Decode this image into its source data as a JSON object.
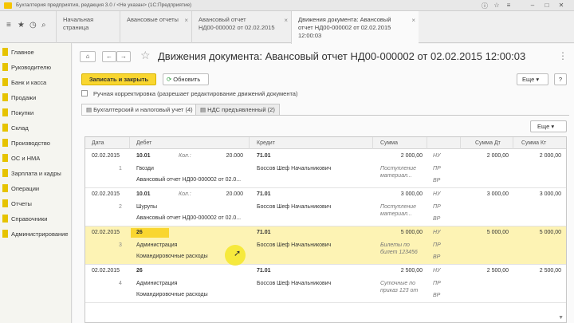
{
  "window": {
    "title": "Бухгалтерия предприятия, редакция 3.0 / <Не указан> (1С:Предприятие)"
  },
  "tabs": [
    {
      "label": "Начальная страница",
      "sub": ""
    },
    {
      "label": "Авансовые отчеты",
      "sub": ""
    },
    {
      "label": "Авансовый отчет",
      "sub": "НД00-000002 от 02.02.2015"
    },
    {
      "label": "Движения документа: Авансовый",
      "sub": "отчет НД00-000002 от 02.02.2015 12:00:03"
    }
  ],
  "sidebar": {
    "items": [
      {
        "label": "Главное"
      },
      {
        "label": "Руководителю"
      },
      {
        "label": "Банк и касса"
      },
      {
        "label": "Продажи"
      },
      {
        "label": "Покупки"
      },
      {
        "label": "Склад"
      },
      {
        "label": "Производство"
      },
      {
        "label": "ОС и НМА"
      },
      {
        "label": "Зарплата и кадры"
      },
      {
        "label": "Операции"
      },
      {
        "label": "Отчеты"
      },
      {
        "label": "Справочники"
      },
      {
        "label": "Администрирование"
      }
    ]
  },
  "main": {
    "title": "Движения документа: Авансовый отчет НД00-000002 от 02.02.2015 12:00:03",
    "more_label": "Еще",
    "save_close_label": "Записать и закрыть",
    "refresh_label": "Обновить",
    "manual_label": "Ручная корректировка (разрешает редактирование движений документа)",
    "inner_tabs": [
      {
        "label": "Бухгалтерский и налоговый учет (4)"
      },
      {
        "label": "НДС предъявленный (2)"
      }
    ],
    "table_more_label": "Еще"
  },
  "table": {
    "headers": {
      "date": "Дата",
      "debit": "Дебет",
      "credit": "Кредит",
      "amount": "Сумма",
      "amount_dt": "Сумма Дт",
      "amount_kt": "Сумма Кт"
    },
    "rows": [
      {
        "date": "02.02.2015",
        "num": "1",
        "debit_acc": "10.01",
        "qty_label": "Кол.:",
        "qty": "20.000",
        "debit_sub1": "Гвозди",
        "debit_sub2": "Авансовый отчет НД00-000002 от 02.0...",
        "credit_acc": "71.01",
        "credit_sub1": "Боссов Шеф Начальникович",
        "amount": "2 000,00",
        "content1": "Поступление",
        "content2": "материал...",
        "nu": "НУ",
        "pr": "ПР",
        "vr": "ВР",
        "amount_dt": "2 000,00",
        "amount_kt": "2 000,00"
      },
      {
        "date": "02.02.2015",
        "num": "2",
        "debit_acc": "10.01",
        "qty_label": "Кол.:",
        "qty": "20.000",
        "debit_sub1": "Шурупы",
        "debit_sub2": "Авансовый отчет НД00-000002 от 02.0...",
        "credit_acc": "71.01",
        "credit_sub1": "Боссов Шеф Начальникович",
        "amount": "3 000,00",
        "content1": "Поступление",
        "content2": "материал...",
        "nu": "НУ",
        "pr": "ПР",
        "vr": "ВР",
        "amount_dt": "3 000,00",
        "amount_kt": "3 000,00"
      },
      {
        "date": "02.02.2015",
        "num": "3",
        "debit_acc": "26",
        "qty_label": "",
        "qty": "",
        "debit_sub1": "Администрация",
        "debit_sub2": "Командировочные расходы",
        "credit_acc": "71.01",
        "credit_sub1": "Боссов Шеф Начальникович",
        "amount": "5 000,00",
        "content1": "Билеты по",
        "content2": "билет 123456",
        "nu": "НУ",
        "pr": "ПР",
        "vr": "ВР",
        "amount_dt": "5 000,00",
        "amount_kt": "5 000,00"
      },
      {
        "date": "02.02.2015",
        "num": "4",
        "debit_acc": "26",
        "qty_label": "",
        "qty": "",
        "debit_sub1": "Администрация",
        "debit_sub2": "Командировочные расходы",
        "credit_acc": "71.01",
        "credit_sub1": "Боссов Шеф Начальникович",
        "amount": "2 500,00",
        "content1": "Суточные по",
        "content2": "приказ 123 от",
        "nu": "НУ",
        "pr": "ПР",
        "vr": "ВР",
        "amount_dt": "2 500,00",
        "amount_kt": "2 500,00"
      }
    ]
  }
}
